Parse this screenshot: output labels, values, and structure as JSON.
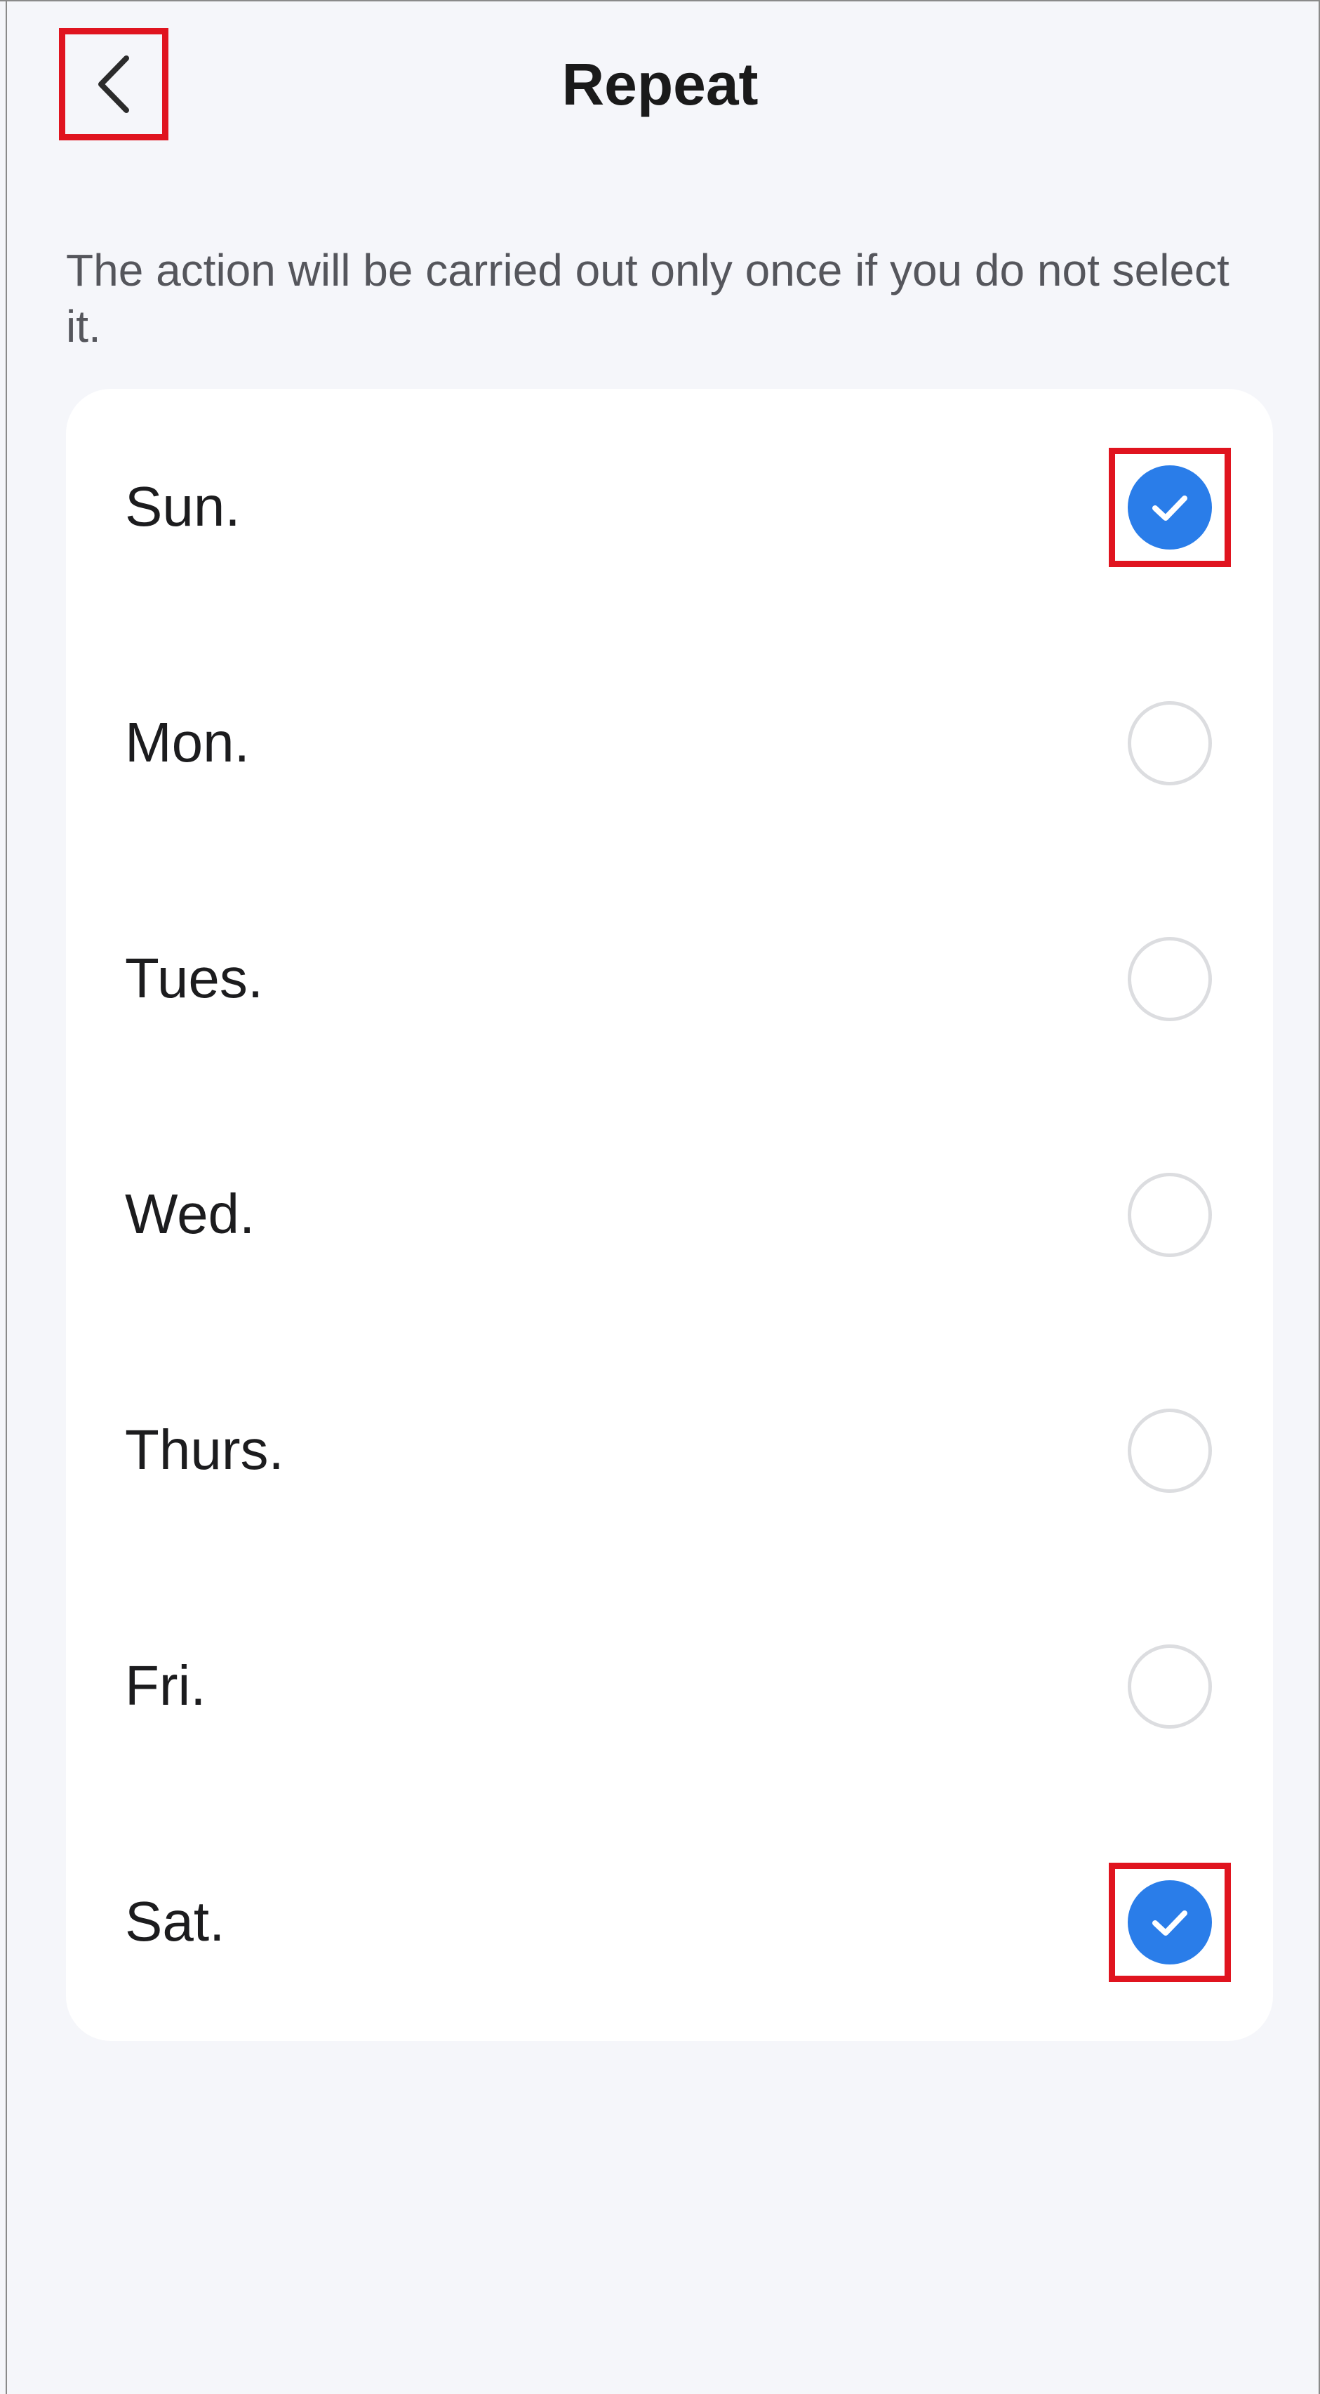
{
  "header": {
    "title": "Repeat",
    "back_icon": "chevron-left-icon"
  },
  "hint": "The action will be carried out only once if you do not select it.",
  "days": [
    {
      "label": "Sun.",
      "checked": true,
      "highlighted": true
    },
    {
      "label": "Mon.",
      "checked": false,
      "highlighted": false
    },
    {
      "label": "Tues.",
      "checked": false,
      "highlighted": false
    },
    {
      "label": "Wed.",
      "checked": false,
      "highlighted": false
    },
    {
      "label": "Thurs.",
      "checked": false,
      "highlighted": false
    },
    {
      "label": "Fri.",
      "checked": false,
      "highlighted": false
    },
    {
      "label": "Sat.",
      "checked": true,
      "highlighted": true
    }
  ],
  "colors": {
    "accent": "#2a7de9",
    "highlight_box": "#e0141f",
    "background": "#f5f6fa",
    "card": "#ffffff"
  }
}
